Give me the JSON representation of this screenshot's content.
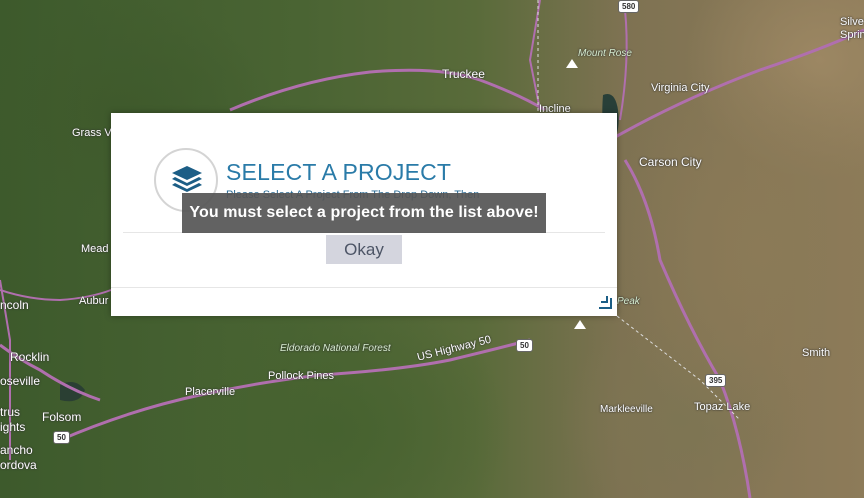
{
  "map": {
    "labels": {
      "truckee": "Truckee",
      "mount_rose": "Mount Rose",
      "virginia_city": "Virginia City",
      "incline": "Incline",
      "carson_city": "Carson City",
      "silver_springs": "Silve Sprin",
      "grass_valley": "Grass V",
      "meadow": "Mead",
      "lincoln": "ncoln",
      "auburn": "Aubur",
      "rocklin": "Rocklin",
      "roseville": "oseville",
      "citrus_heights": "trus ights",
      "folsom": "Folsom",
      "rancho_cordova": "ancho ordova",
      "eldorado_nf": "Eldorado National Forest",
      "pollock_pines": "Pollock Pines",
      "placerville": "Placerville",
      "us_highway_50": "US Highway 50",
      "markleeville": "Markleeville",
      "topaz_lake": "Topaz Lake",
      "smith": "Smith",
      "peak": "Peak"
    },
    "shields": {
      "i580": "580",
      "us50_east": "50",
      "us50_west": "50",
      "us395": "395"
    }
  },
  "modal": {
    "title": "SELECT A PROJECT",
    "subtitle": "Please Select A Project From The Drop Down, Then",
    "okay_label": "Okay",
    "icon": "layers-icon"
  },
  "toast": {
    "message": "You must select a project from the list above!"
  }
}
